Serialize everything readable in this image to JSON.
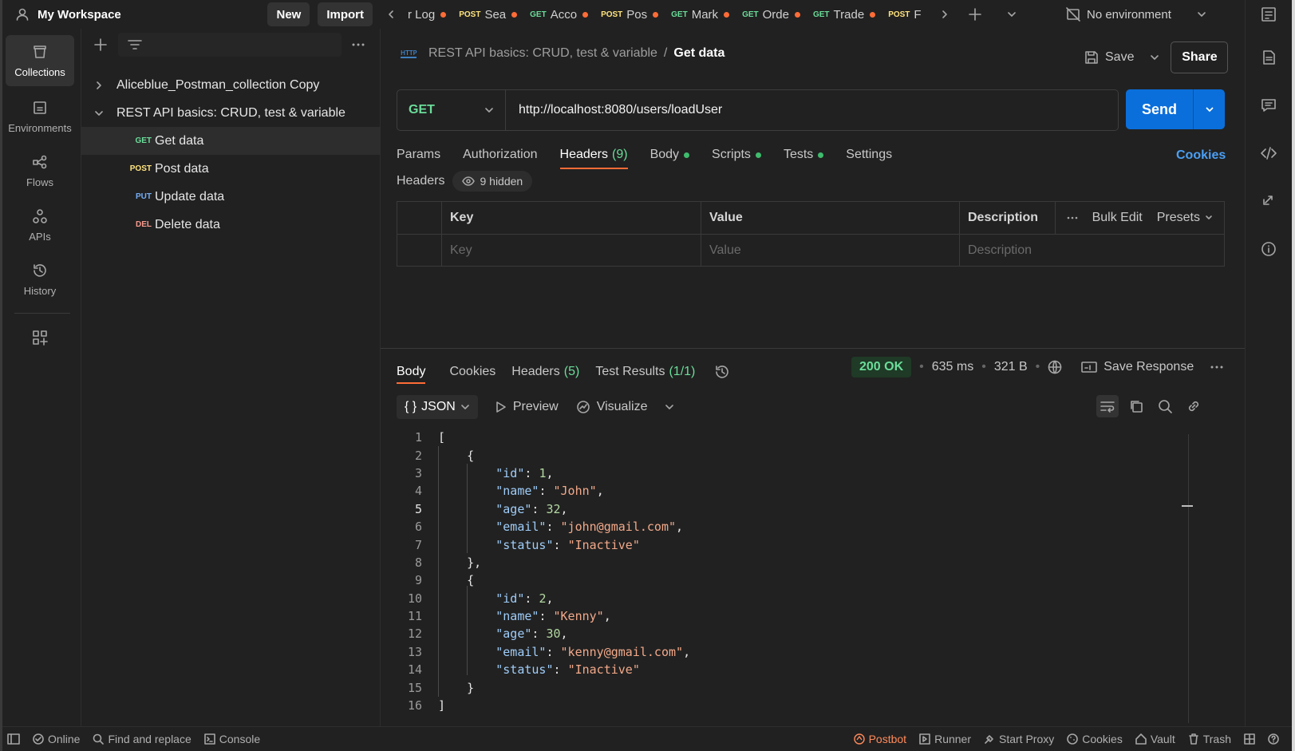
{
  "workspace": {
    "name": "My Workspace",
    "new_label": "New",
    "import_label": "Import"
  },
  "tabs": [
    {
      "method": "",
      "label": "r Log"
    },
    {
      "method": "POST",
      "label": "Sea"
    },
    {
      "method": "GET",
      "label": "Acco"
    },
    {
      "method": "POST",
      "label": "Pos"
    },
    {
      "method": "GET",
      "label": "Mark"
    },
    {
      "method": "GET",
      "label": "Orde"
    },
    {
      "method": "GET",
      "label": "Trade"
    },
    {
      "method": "POST",
      "label": "F"
    }
  ],
  "environment": {
    "label": "No environment"
  },
  "rail": [
    {
      "label": "Collections",
      "icon": "collections-icon"
    },
    {
      "label": "Environments",
      "icon": "environments-icon"
    },
    {
      "label": "Flows",
      "icon": "flows-icon"
    },
    {
      "label": "APIs",
      "icon": "apis-icon"
    },
    {
      "label": "History",
      "icon": "history-icon"
    }
  ],
  "sidebar": {
    "collections": [
      {
        "name": "Aliceblue_Postman_collection Copy",
        "expanded": false
      },
      {
        "name": "REST API basics: CRUD, test & variable",
        "expanded": true
      }
    ],
    "requests": [
      {
        "method": "GET",
        "name": "Get data"
      },
      {
        "method": "POST",
        "name": "Post data"
      },
      {
        "method": "PUT",
        "name": "Update data"
      },
      {
        "method": "DEL",
        "name": "Delete data"
      }
    ]
  },
  "request": {
    "breadcrumb_collection": "REST API basics: CRUD, test & variable",
    "breadcrumb_sep": "/",
    "breadcrumb_request": "Get data",
    "save_label": "Save",
    "share_label": "Share",
    "method": "GET",
    "url": "http://localhost:8080/users/loadUser",
    "send_label": "Send",
    "tabs": {
      "params": "Params",
      "authorization": "Authorization",
      "headers": "Headers",
      "headers_count": "(9)",
      "body": "Body",
      "scripts": "Scripts",
      "tests": "Tests",
      "settings": "Settings"
    },
    "cookies_label": "Cookies",
    "headers_title": "Headers",
    "hidden_label": "9 hidden",
    "table": {
      "key": "Key",
      "value": "Value",
      "description": "Description",
      "bulk_edit": "Bulk Edit",
      "presets": "Presets",
      "key_ph": "Key",
      "value_ph": "Value",
      "description_ph": "Description"
    }
  },
  "response": {
    "tabs": {
      "body": "Body",
      "cookies": "Cookies",
      "headers": "Headers",
      "headers_count": "(5)",
      "tests": "Test Results",
      "tests_count": "(1/1)"
    },
    "status": "200 OK",
    "time": "635 ms",
    "size": "321 B",
    "save_response": "Save Response",
    "format": "JSON",
    "preview": "Preview",
    "visualize": "Visualize",
    "lines": [
      "[",
      "    {",
      "        \"id\": 1,",
      "        \"name\": \"John\",",
      "        \"age\": 32,",
      "        \"email\": \"john@gmail.com\",",
      "        \"status\": \"Inactive\"",
      "    },",
      "    {",
      "        \"id\": 2,",
      "        \"name\": \"Kenny\",",
      "        \"age\": 30,",
      "        \"email\": \"kenny@gmail.com\",",
      "        \"status\": \"Inactive\"",
      "    }",
      "]"
    ],
    "current_line": 5
  },
  "statusbar": {
    "online": "Online",
    "find_replace": "Find and replace",
    "console": "Console",
    "postbot": "Postbot",
    "runner": "Runner",
    "start_proxy": "Start Proxy",
    "cookies": "Cookies",
    "vault": "Vault",
    "trash": "Trash"
  }
}
